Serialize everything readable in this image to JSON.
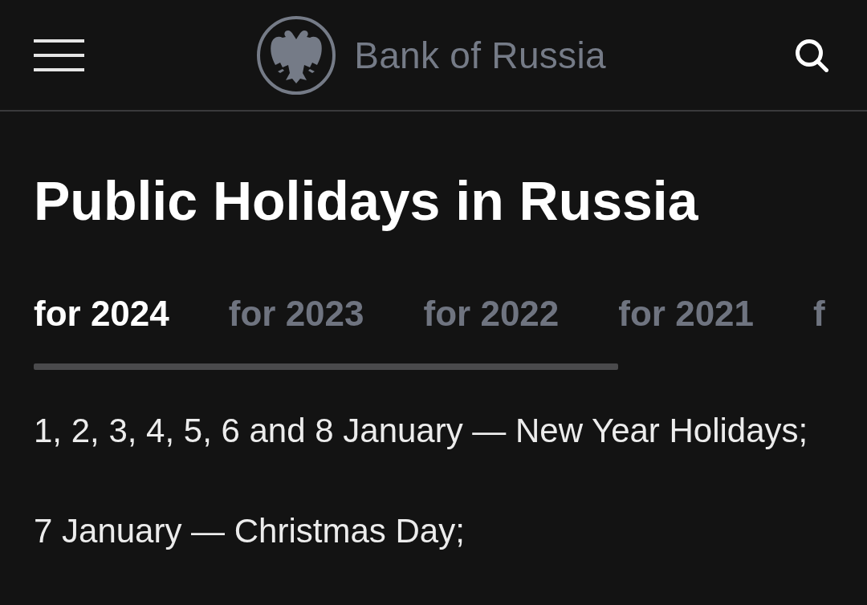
{
  "header": {
    "brand": "Bank of Russia"
  },
  "page": {
    "title": "Public Holidays in Russia"
  },
  "tabs": [
    {
      "label": "for 2024",
      "selected": true
    },
    {
      "label": "for 2023",
      "selected": false
    },
    {
      "label": "for 2022",
      "selected": false
    },
    {
      "label": "for 2021",
      "selected": false
    },
    {
      "label": "f",
      "selected": false
    }
  ],
  "holidays": [
    "1, 2, 3, 4, 5, 6 and 8 January — New Year Holidays;",
    "7 January — Christmas Day;"
  ]
}
